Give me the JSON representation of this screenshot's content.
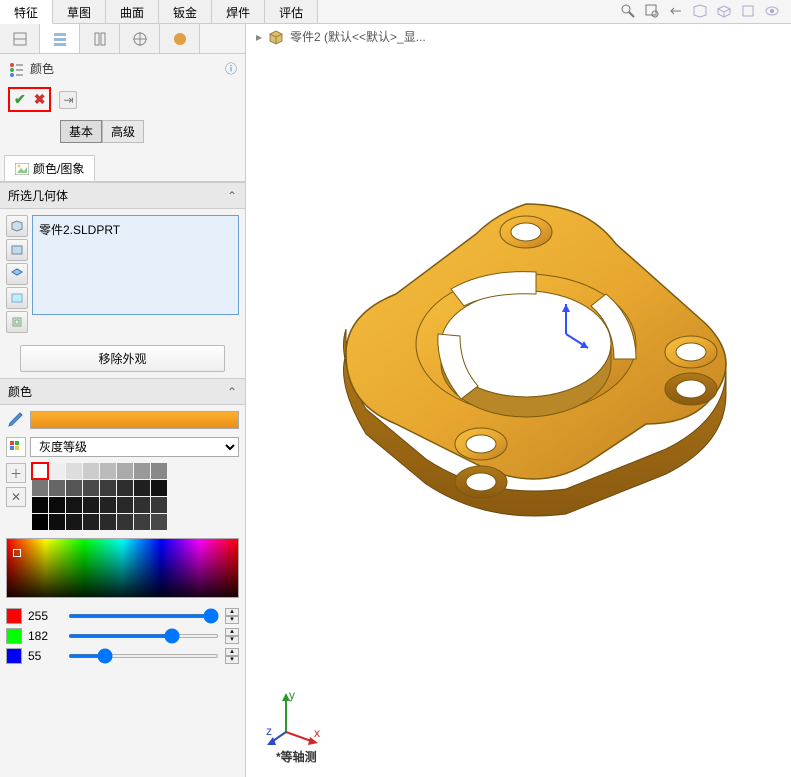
{
  "tabs": [
    "特征",
    "草图",
    "曲面",
    "钣金",
    "焊件",
    "评估"
  ],
  "active_tab": 0,
  "breadcrumb": {
    "part_label": "零件2  (默认<<默认>_显..."
  },
  "panel": {
    "title": "颜色",
    "basic": "基本",
    "advanced": "高级",
    "sub_tab": "颜色/图象",
    "section_geom": "所选几何体",
    "geom_item": "零件2.SLDPRT",
    "remove_label": "移除外观",
    "section_color": "颜色",
    "gray_scale_label": "灰度等级",
    "rgb": {
      "r": "255",
      "g": "182",
      "b": "55"
    }
  },
  "view_label": "*等轴测"
}
